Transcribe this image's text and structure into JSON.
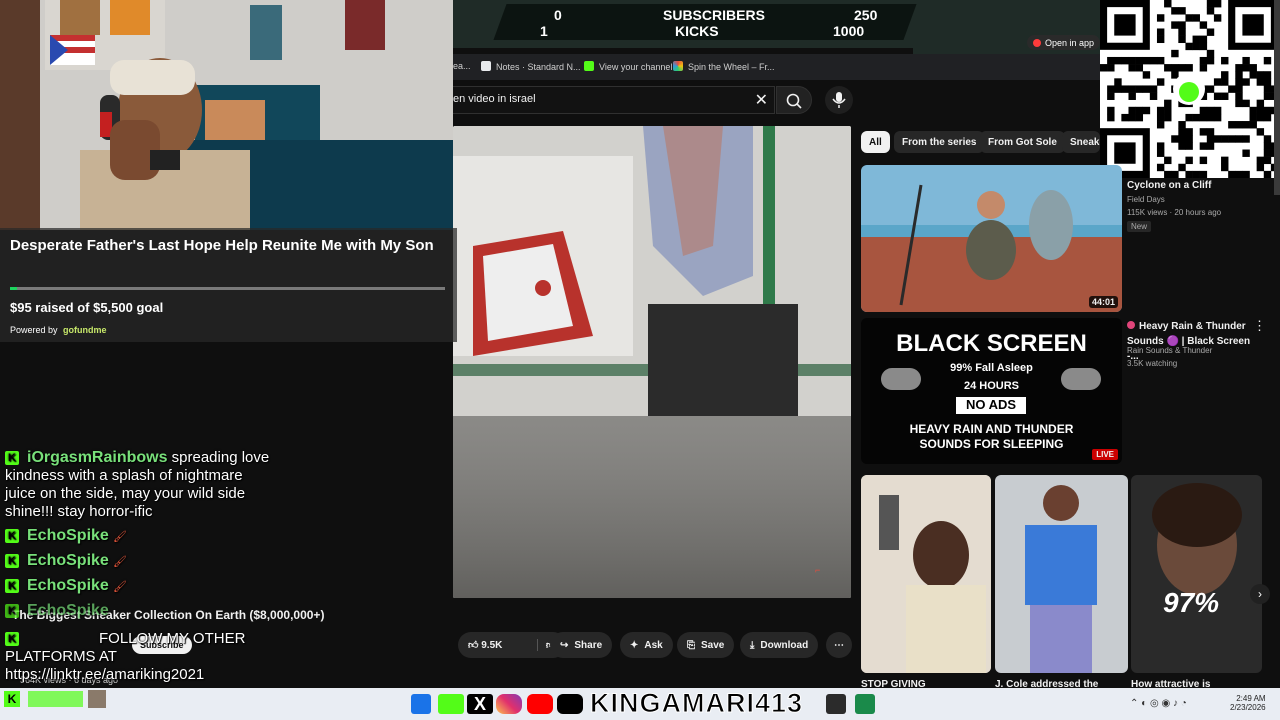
{
  "counter": {
    "subscribers_current": "0",
    "subscribers_label": "SUBSCRIBERS",
    "subscribers_goal": "250",
    "kicks_current": "1",
    "kicks_label": "KICKS",
    "kicks_goal": "1000"
  },
  "open_in_app": "Open in app",
  "bookmarks": [
    {
      "label": "ea...",
      "color": "#888888"
    },
    {
      "label": "Notes · Standard N...",
      "color": "#e8eaed"
    },
    {
      "label": "View your channel",
      "color": "#53fc18"
    },
    {
      "label": "Spin the Wheel – Fr...",
      "color": "#e84c3d"
    }
  ],
  "search": {
    "query": "en video in israel"
  },
  "fundraiser": {
    "title": "Desperate Father's Last Hope Help Reunite Me with My Son",
    "raised": "$95 raised of $5,500 goal",
    "progress_fraction": 0.017,
    "powered_by": "Powered by",
    "brand": "gofundme"
  },
  "chat": [
    {
      "user": "iOrgasmRainbows",
      "text": "spreading love kindness with a splash of nightmare juice on the side, may your wild side shine!!! stay horror-ific"
    },
    {
      "user": "EchoSpike",
      "text": ""
    },
    {
      "user": "EchoSpike",
      "text": ""
    },
    {
      "user": "EchoSpike",
      "text": ""
    },
    {
      "user": "EchoSpike",
      "text": ""
    }
  ],
  "bot_message": {
    "line1": "FOLLOW MY OTHER",
    "line2": "PLATFORMS AT",
    "line3": "https://linktr.ee/amariking2021"
  },
  "video": {
    "title": "The Biggest Sneaker Collection On Earth ($8,000,000+)",
    "meta": "564K views · 6 days ago",
    "subscribe": "Subscribe",
    "like_count": "9.5K",
    "share": "Share",
    "ask": "Ask",
    "save": "Save",
    "download": "Download"
  },
  "chips": [
    "All",
    "From the series",
    "From Got Sole",
    "Sneake"
  ],
  "recommendations": [
    {
      "title": "Cyclone on a Cliff",
      "channel": "Field Days",
      "meta": "115K views · 20 hours ago",
      "badge": "New",
      "duration": "44:01"
    },
    {
      "title": "Heavy Rain & Thunder Sounds 🟣 | Black Screen -...",
      "channel": "Rain Sounds & Thunder",
      "meta": "3.5K watching",
      "live": "LIVE"
    }
  ],
  "thumb_black": {
    "headline": "BLACK SCREEN",
    "sub": "99% Fall Asleep",
    "hours": "24 HOURS",
    "noads": "NO ADS",
    "footer1": "HEAVY RAIN AND THUNDER",
    "footer2": "SOUNDS FOR SLEEPING",
    "tag": "LIVE"
  },
  "shorts": [
    {
      "title": "STOP GIVING"
    },
    {
      "title": "J. Cole addressed the"
    },
    {
      "title": "How attractive is",
      "overlay": "97%"
    }
  ],
  "kick_username": "KINGAMARI413",
  "clock": {
    "time": "2:49 AM",
    "date": "2/23/2026"
  },
  "colors": {
    "kick_green": "#53fc18",
    "yt_red": "#ff0000",
    "bg": "#0f0f0f"
  }
}
